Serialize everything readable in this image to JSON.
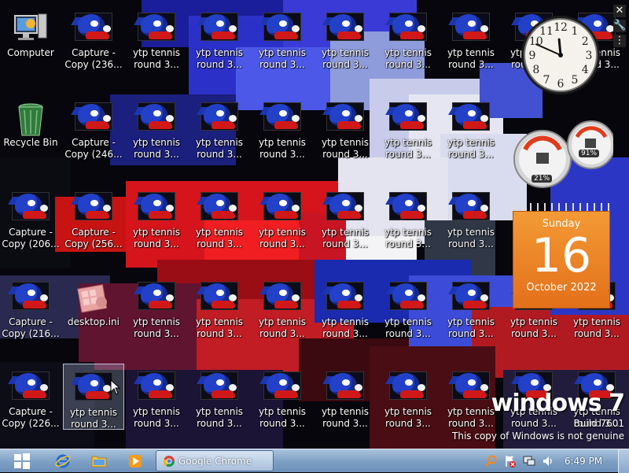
{
  "desktop": {
    "icons": [
      {
        "label": "Computer",
        "kind": "computer"
      },
      {
        "label": "Capture -\nCopy (236...",
        "kind": "sonic"
      },
      {
        "label": "ytp tennis\nround 3...",
        "kind": "sonic"
      },
      {
        "label": "ytp tennis\nround 3...",
        "kind": "sonic"
      },
      {
        "label": "ytp tennis\nround 3...",
        "kind": "sonic"
      },
      {
        "label": "ytp tennis\nround 3...",
        "kind": "sonic"
      },
      {
        "label": "ytp tennis\nround 3...",
        "kind": "sonic"
      },
      {
        "label": "ytp tennis\nround 3...",
        "kind": "sonic"
      },
      {
        "label": "ytp tennis\nround 3...",
        "kind": "sonic"
      },
      {
        "label": "ytp tennis\nround 3...",
        "kind": "sonic"
      },
      {
        "label": "Recycle Bin",
        "kind": "recycle"
      },
      {
        "label": "Capture -\nCopy (246...",
        "kind": "sonic"
      },
      {
        "label": "ytp tennis\nround 3...",
        "kind": "sonic"
      },
      {
        "label": "ytp tennis\nround 3...",
        "kind": "sonic"
      },
      {
        "label": "ytp tennis\nround 3...",
        "kind": "sonic"
      },
      {
        "label": "ytp tennis\nround 3...",
        "kind": "sonic"
      },
      {
        "label": "ytp tennis\nround 3...",
        "kind": "sonic"
      },
      {
        "label": "ytp tennis\nround 3...",
        "kind": "sonic"
      },
      {
        "label": "Capture -\nCopy (206...",
        "kind": "sonic"
      },
      {
        "label": "Capture -\nCopy (256...",
        "kind": "sonic"
      },
      {
        "label": "ytp tennis\nround 3...",
        "kind": "sonic"
      },
      {
        "label": "ytp tennis\nround 3...",
        "kind": "sonic"
      },
      {
        "label": "ytp tennis\nround 3...",
        "kind": "sonic"
      },
      {
        "label": "ytp tennis\nround 3...",
        "kind": "sonic"
      },
      {
        "label": "ytp tennis\nround 3...",
        "kind": "sonic"
      },
      {
        "label": "ytp tennis\nround 3...",
        "kind": "sonic"
      },
      {
        "label": "Capture -\nCopy (216...",
        "kind": "sonic"
      },
      {
        "label": "desktop.ini",
        "kind": "ini"
      },
      {
        "label": "ytp tennis\nround 3...",
        "kind": "sonic"
      },
      {
        "label": "ytp tennis\nround 3...",
        "kind": "sonic"
      },
      {
        "label": "ytp tennis\nround 3...",
        "kind": "sonic"
      },
      {
        "label": "ytp tennis\nround 3...",
        "kind": "sonic"
      },
      {
        "label": "ytp tennis\nround 3...",
        "kind": "sonic"
      },
      {
        "label": "ytp tennis\nround 3...",
        "kind": "sonic"
      },
      {
        "label": "ytp tennis\nround 3...",
        "kind": "sonic"
      },
      {
        "label": "ytp tennis\nround 3...",
        "kind": "sonic"
      },
      {
        "label": "Capture -\nCopy (226...",
        "kind": "sonic"
      },
      {
        "label": "ytp tennis\nround 3...",
        "kind": "sonic",
        "selected": true
      },
      {
        "label": "ytp tennis\nround 3...",
        "kind": "sonic"
      },
      {
        "label": "ytp tennis\nround 3...",
        "kind": "sonic"
      },
      {
        "label": "ytp tennis\nround 3...",
        "kind": "sonic"
      },
      {
        "label": "ytp tennis\nround 3...",
        "kind": "sonic"
      },
      {
        "label": "ytp tennis\nround 3...",
        "kind": "sonic"
      },
      {
        "label": "ytp tennis\nround 3...",
        "kind": "sonic"
      },
      {
        "label": "ytp tennis\nround 3...",
        "kind": "sonic"
      },
      {
        "label": "ytp tennis\nround 3...",
        "kind": "sonic"
      }
    ]
  },
  "gadgets": {
    "clock": {
      "hour": 11,
      "minute": 49
    },
    "cpu_meter": {
      "cpu": "21%",
      "memory": "91%"
    },
    "calendar": {
      "weekday": "Sunday",
      "day": "16",
      "month_year": "October 2022"
    }
  },
  "branding": {
    "logo": "windows 7",
    "build": "Build 7601",
    "genuine": "This copy of Windows is not genuine"
  },
  "taskbar": {
    "chrome_label": "Google Chrome",
    "time": "6:49 PM",
    "pinned": [
      "internet-explorer-icon",
      "file-explorer-icon",
      "media-player-icon"
    ],
    "tray": [
      "search-icon",
      "action-center-icon",
      "network-icon",
      "volume-icon"
    ]
  },
  "colors": {
    "taskbar": "#7d9fc4",
    "calendar": "#ef8a2a",
    "selection": "#c8dcff"
  }
}
